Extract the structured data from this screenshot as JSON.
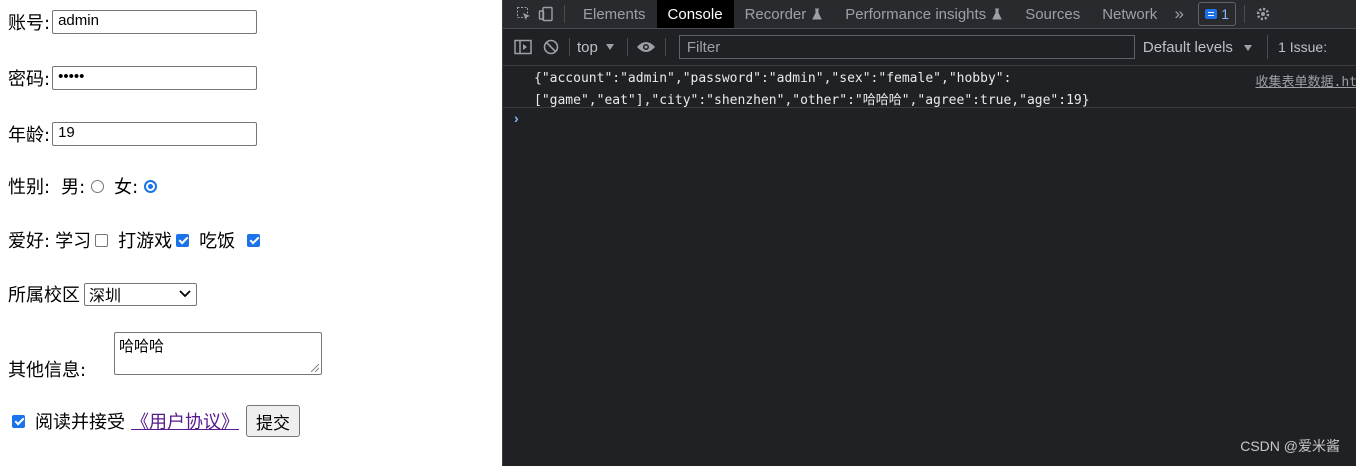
{
  "form": {
    "account": {
      "label": "账号:",
      "value": "admin"
    },
    "password": {
      "label": "密码:",
      "value": "•••••"
    },
    "age": {
      "label": "年龄:",
      "value": "19"
    },
    "sex": {
      "label": "性别:",
      "options": [
        {
          "label": "男:",
          "checked": false
        },
        {
          "label": "女:",
          "checked": true
        }
      ]
    },
    "hobby": {
      "label": "爱好:",
      "options": [
        {
          "label": "学习",
          "checked": false
        },
        {
          "label": "打游戏",
          "checked": true
        },
        {
          "label": "吃饭",
          "checked": true
        }
      ]
    },
    "campus": {
      "label": "所属校区",
      "selected": "深圳"
    },
    "other": {
      "label": "其他信息:",
      "value": "哈哈哈"
    },
    "agree": {
      "checked": true,
      "label": "阅读并接受",
      "link": "《用户协议》",
      "submit": "提交"
    }
  },
  "devtools": {
    "tabs": [
      "Elements",
      "Console",
      "Recorder",
      "Performance insights",
      "Sources",
      "Network"
    ],
    "active_tab": "Console",
    "more": "»",
    "message_badge": "1",
    "context": "top",
    "filter_placeholder": "Filter",
    "levels": "Default levels",
    "issues": "1 Issue:",
    "log_line1": "{\"account\":\"admin\",\"password\":\"admin\",\"sex\":\"female\",\"hobby\":",
    "log_line2": "[\"game\",\"eat\"],\"city\":\"shenzhen\",\"other\":\"哈哈哈\",\"agree\":true,\"age\":19}",
    "log_source": "收集表单数据.ht",
    "prompt": "›"
  },
  "watermark": "CSDN @爱米酱",
  "colors": {
    "accent": "#1a73e8",
    "devtools_bg": "#202124",
    "link": "#551a8b"
  }
}
